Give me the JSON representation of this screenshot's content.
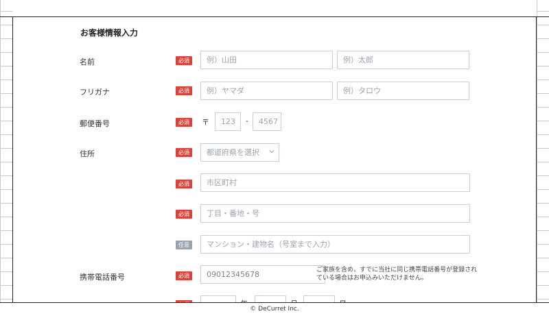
{
  "section_title": "お客様情報入力",
  "badges": {
    "required": "必須",
    "optional": "任意"
  },
  "fields": {
    "name": {
      "label": "名前",
      "last_placeholder": "例）山田",
      "first_placeholder": "例）太郎"
    },
    "furigana": {
      "label": "フリガナ",
      "last_placeholder": "例）ヤマダ",
      "first_placeholder": "例）タロウ"
    },
    "postal": {
      "label": "郵便番号",
      "mark": "〒",
      "part1_placeholder": "123",
      "separator": "-",
      "part2_placeholder": "4567"
    },
    "address": {
      "label": "住所",
      "prefecture_placeholder": "都道府県を選択",
      "city_placeholder": "市区町村",
      "block_placeholder": "丁目・番地・号",
      "building_placeholder": "マンション・建物名（号室まで入力）"
    },
    "mobile": {
      "label": "携帯電話番号",
      "placeholder": "09012345678",
      "note": "ご家族を含め、すでに当社に同じ携帯電話番号が登録されている場合はお申込みいただけません。"
    },
    "birthdate": {
      "year_suffix": "年",
      "month_suffix": "月",
      "day_suffix": "日"
    }
  },
  "footer": "© DeCurret Inc."
}
